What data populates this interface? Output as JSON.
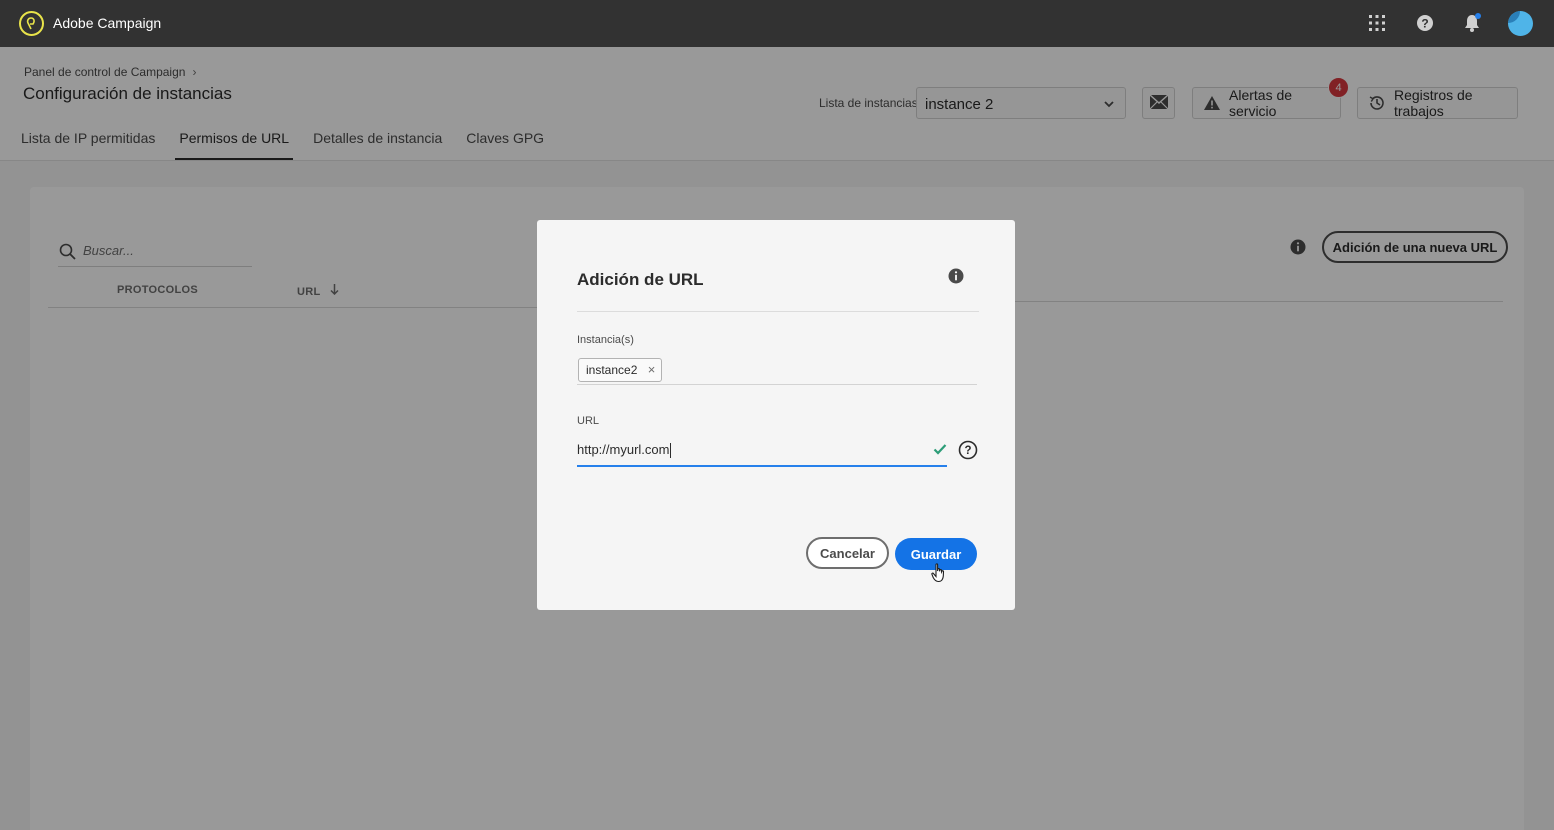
{
  "app": {
    "title": "Adobe Campaign"
  },
  "header": {
    "breadcrumb": "Panel de control de Campaign",
    "page_title": "Configuración de instancias",
    "tabs": [
      {
        "label": "Lista de IP permitidas"
      },
      {
        "label": "Permisos de URL",
        "active": true
      },
      {
        "label": "Detalles de instancia"
      },
      {
        "label": "Claves GPG"
      }
    ],
    "instance_list_label": "Lista de instancias",
    "instance_selected": "instance 2",
    "alerts_label": "Alertas de servicio",
    "alerts_count": "4",
    "logs_label": "Registros de trabajos"
  },
  "main": {
    "search_placeholder": "Buscar...",
    "columns": [
      "PROTOCOLOS",
      "URL"
    ],
    "add_url_label": "Adición de una nueva URL"
  },
  "modal": {
    "title": "Adición de URL",
    "instances_label": "Instancia(s)",
    "instance_tag": "instance2",
    "url_label": "URL",
    "url_value": "http://myurl.com",
    "cancel_label": "Cancelar",
    "save_label": "Guardar"
  },
  "icons": {
    "apps": "apps-grid-icon",
    "help": "help-icon",
    "notifications": "bell-icon",
    "mail": "mail-icon",
    "alert": "alert-triangle-icon",
    "history": "history-icon",
    "search": "search-icon",
    "info": "info-icon",
    "check": "check-icon",
    "question": "question-circle-icon"
  },
  "colors": {
    "topbar": "#323232",
    "primary_button": "#1473e6",
    "badge": "#d7373f",
    "valid_check": "#2d9d78",
    "focus_underline": "#2680eb"
  }
}
